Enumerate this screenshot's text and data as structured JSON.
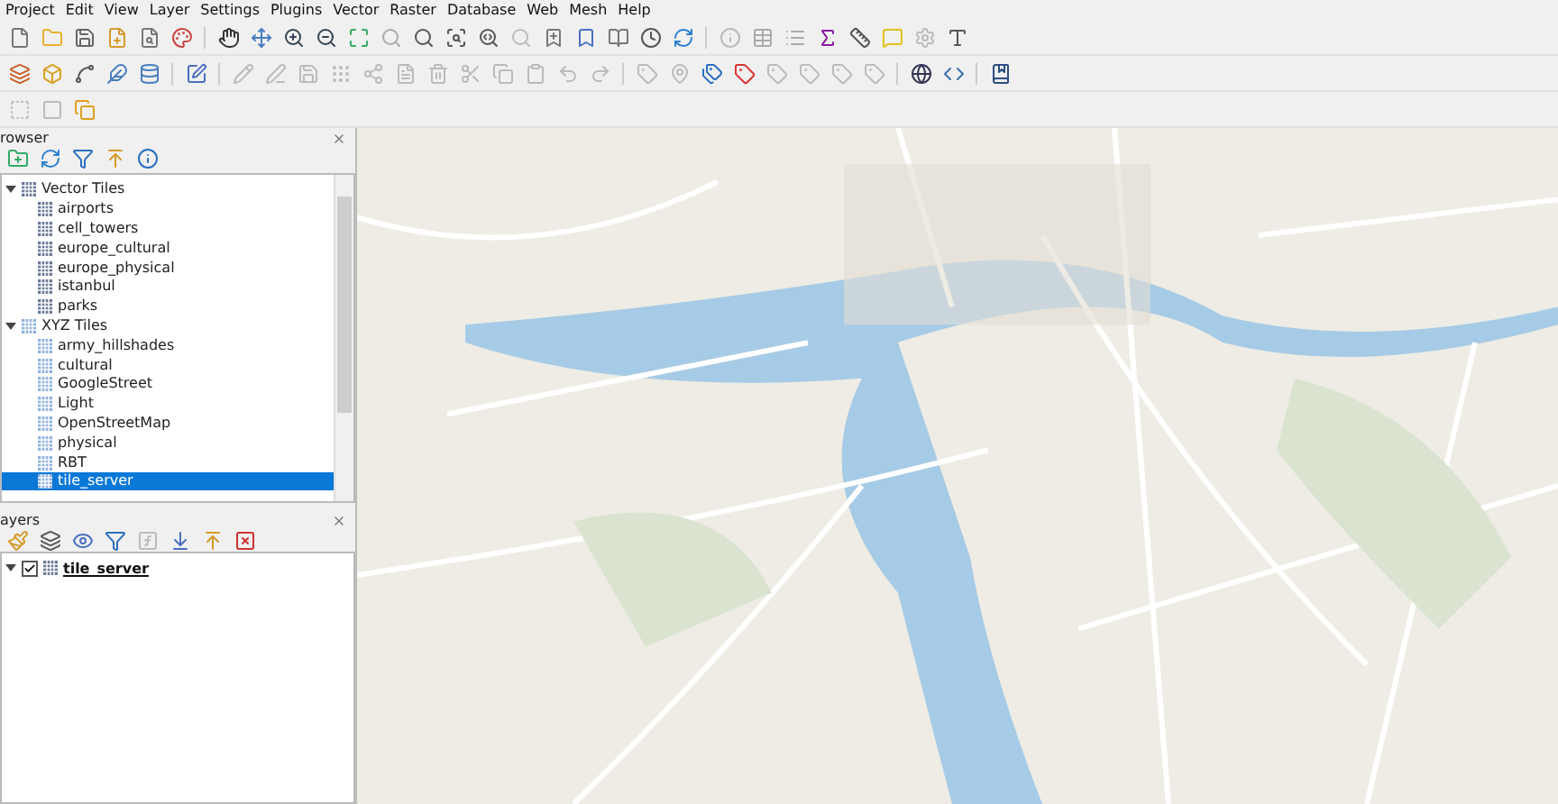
{
  "menu_bar": [
    "Project",
    "Edit",
    "View",
    "Layer",
    "Settings",
    "Plugins",
    "Vector",
    "Raster",
    "Database",
    "Web",
    "Mesh",
    "Help"
  ],
  "browser_panel": {
    "title": "rowser",
    "tree": [
      {
        "label": "Vector Tiles",
        "expanded": true,
        "selected": false,
        "children": [
          {
            "label": "airports",
            "selected": false
          },
          {
            "label": "cell_towers",
            "selected": false
          },
          {
            "label": "europe_cultural",
            "selected": false
          },
          {
            "label": "europe_physical",
            "selected": false
          },
          {
            "label": "istanbul",
            "selected": false
          },
          {
            "label": "parks",
            "selected": false
          }
        ]
      },
      {
        "label": "XYZ Tiles",
        "expanded": true,
        "selected": false,
        "children": [
          {
            "label": "army_hillshades",
            "selected": false
          },
          {
            "label": "cultural",
            "selected": false
          },
          {
            "label": "GoogleStreet",
            "selected": false
          },
          {
            "label": "Light",
            "selected": false
          },
          {
            "label": "OpenStreetMap",
            "selected": false
          },
          {
            "label": "physical",
            "selected": false
          },
          {
            "label": "RBT",
            "selected": false
          },
          {
            "label": "tile_server",
            "selected": true
          }
        ]
      }
    ]
  },
  "layers_panel": {
    "title": "ayers",
    "layers": [
      {
        "label": "tile_server",
        "checked": true,
        "expanded": true
      }
    ]
  }
}
